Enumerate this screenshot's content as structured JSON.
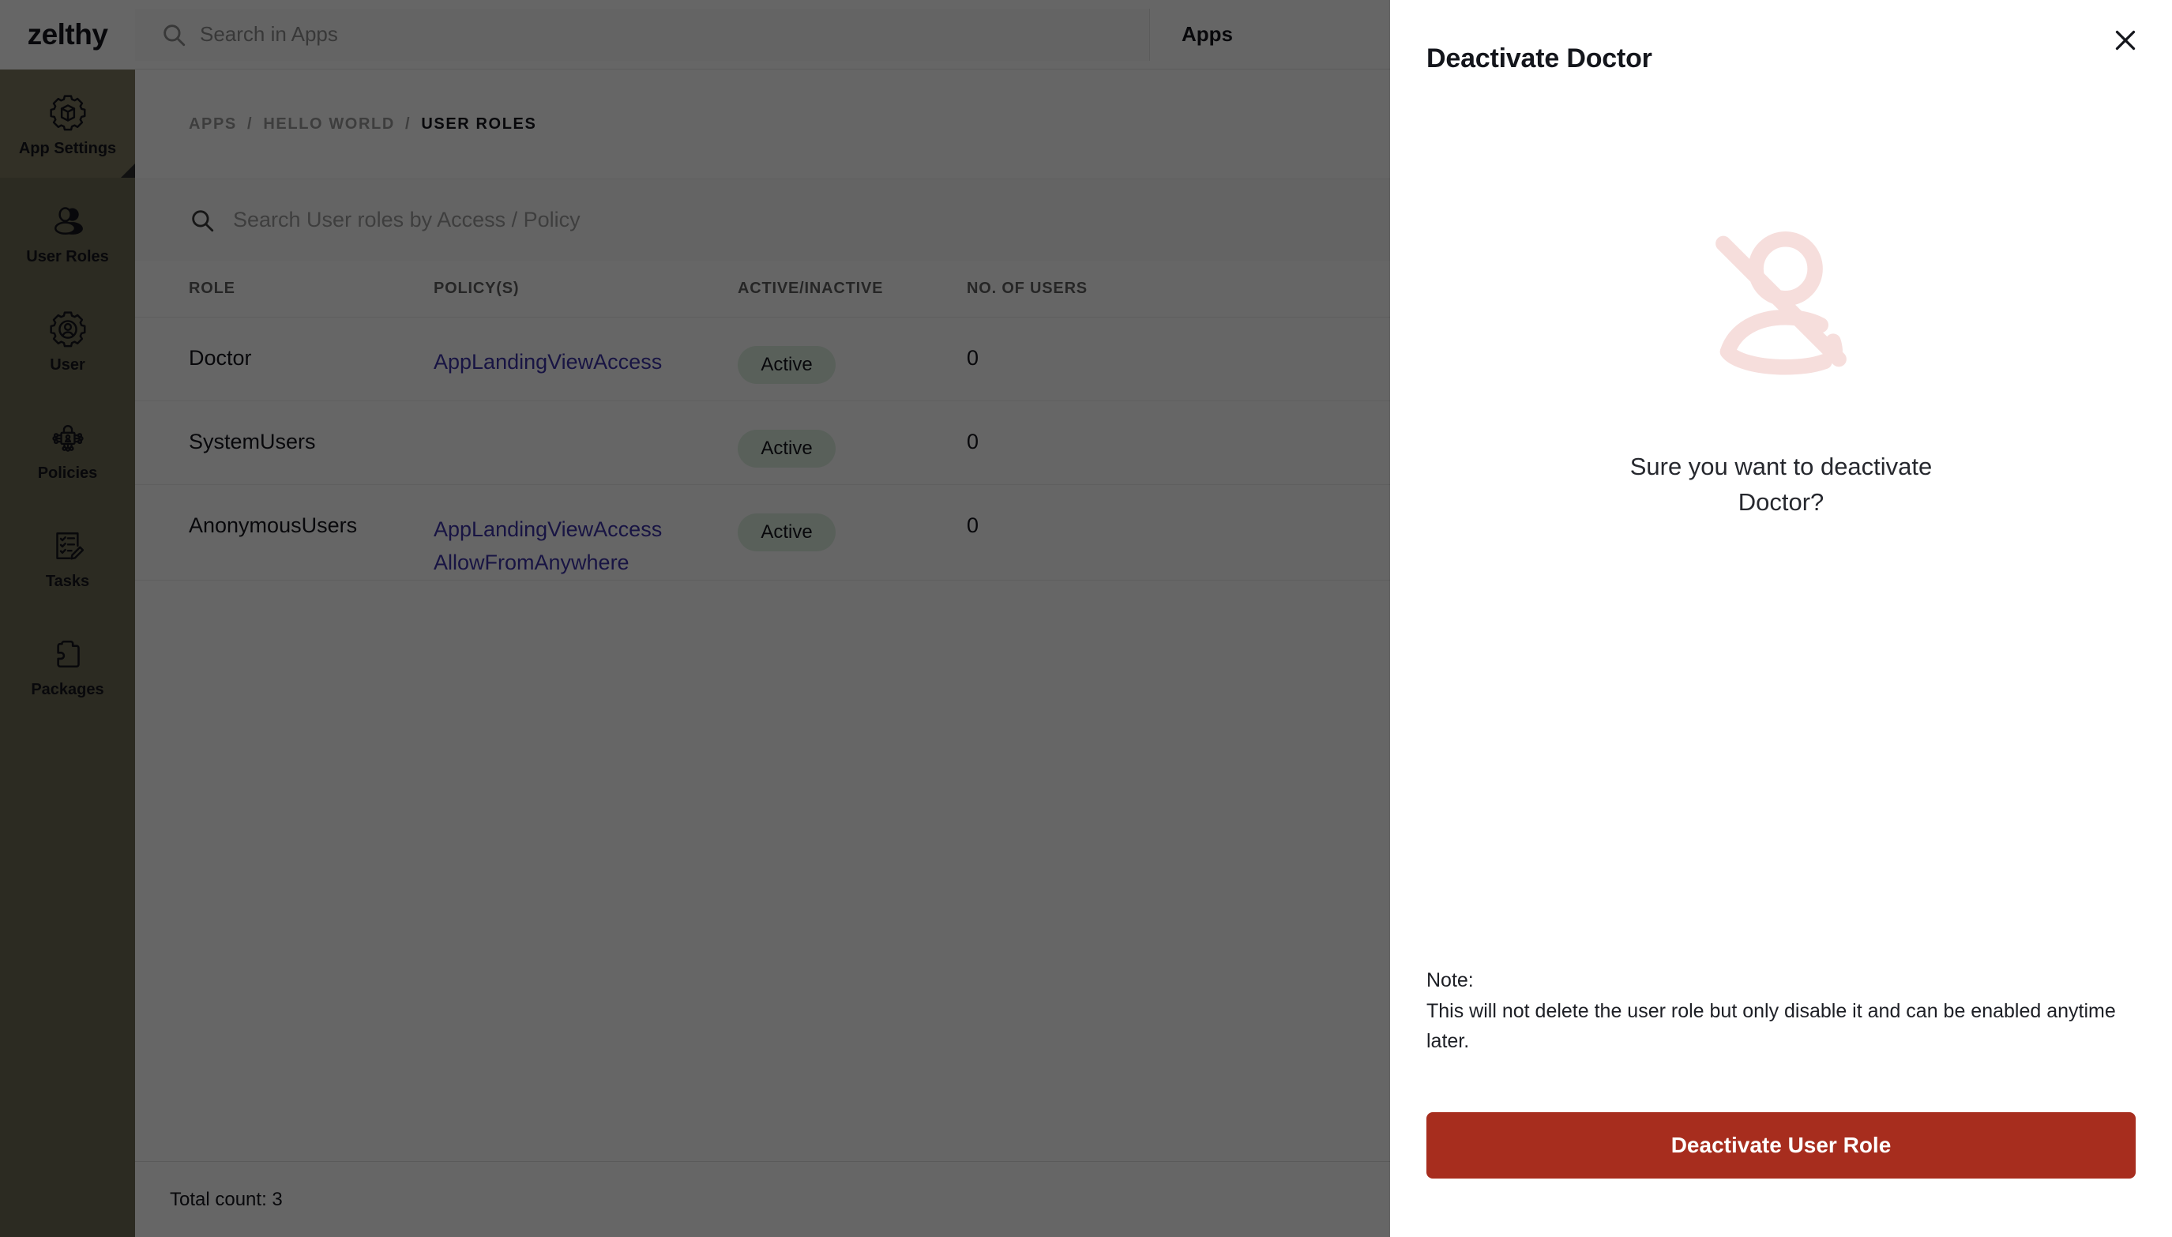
{
  "brand": {
    "name": "zelthy"
  },
  "sidebar": {
    "items": [
      {
        "label": "App Settings",
        "icon": "gear-cube-icon",
        "active": true
      },
      {
        "label": "User Roles",
        "icon": "users-icon",
        "active": false
      },
      {
        "label": "User",
        "icon": "gear-user-icon",
        "active": false
      },
      {
        "label": "Policies",
        "icon": "policy-lock-icon",
        "active": false
      },
      {
        "label": "Tasks",
        "icon": "checklist-edit-icon",
        "active": false
      },
      {
        "label": "Packages",
        "icon": "puzzle-piece-icon",
        "active": false
      }
    ]
  },
  "topbar": {
    "search_placeholder": "Search in Apps",
    "search_value": "",
    "apps_label": "Apps"
  },
  "breadcrumb": {
    "crumbs": [
      "APPS",
      "HELLO WORLD"
    ],
    "separator": "/",
    "current": "USER ROLES"
  },
  "table": {
    "search_placeholder": "Search User roles by Access / Policy",
    "search_value": "",
    "columns": [
      "ROLE",
      "POLICY(S)",
      "ACTIVE/INACTIVE",
      "NO. OF USERS"
    ],
    "rows": [
      {
        "role": "Doctor",
        "policies": [
          "AppLandingViewAccess"
        ],
        "status": "Active",
        "users": "0"
      },
      {
        "role": "SystemUsers",
        "policies": [],
        "status": "Active",
        "users": "0"
      },
      {
        "role": "AnonymousUsers",
        "policies": [
          "AppLandingViewAccess",
          "AllowFromAnywhere"
        ],
        "status": "Active",
        "users": "0"
      }
    ],
    "footer": "Total count: 3"
  },
  "modal": {
    "title": "Deactivate Doctor",
    "close_label": "×",
    "illustration": "user-off-icon",
    "confirm_line1": "Sure you want to deactivate",
    "confirm_line2": "Doctor?",
    "note_label": "Note:",
    "note_body": "This will not delete the user role but only disable it and can be enabled anytime later.",
    "primary_button": "Deactivate User Role"
  },
  "colors": {
    "sidebar_bg": "#6F6B55",
    "sidebar_active_bg": "#7D7960",
    "link": "#3C34A8",
    "status_pill_bg": "#DFF0E2",
    "danger": "#A72D1E",
    "illustration": "#F6DEDC",
    "scrim": "rgba(0,0,0,0.60)"
  }
}
